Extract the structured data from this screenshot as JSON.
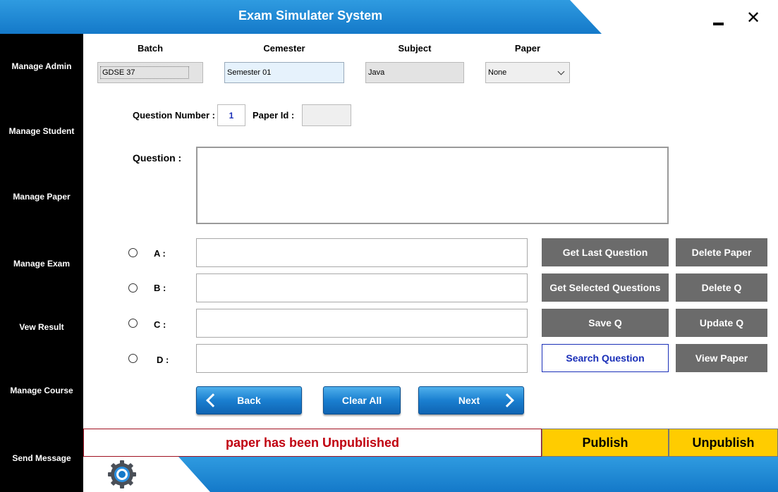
{
  "app": {
    "title": "Exam Simulater System"
  },
  "window": {
    "minimize_icon": "minimize-icon",
    "close_label": "✕"
  },
  "sidebar": {
    "items": [
      {
        "label": "Manage Admin"
      },
      {
        "label": "Manage Student"
      },
      {
        "label": "Manage Paper"
      },
      {
        "label": "Manage Exam"
      },
      {
        "label": "Vew Result"
      },
      {
        "label": "Manage Course"
      },
      {
        "label": "Send Message"
      }
    ]
  },
  "form": {
    "batch": {
      "label": "Batch",
      "value": "GDSE 37"
    },
    "semester": {
      "label": "Cemester",
      "value": "Semester 01"
    },
    "subject": {
      "label": "Subject",
      "value": "Java"
    },
    "paper": {
      "label": "Paper",
      "value": "None"
    },
    "question_number": {
      "label": "Question Number :",
      "value": "1"
    },
    "paper_id": {
      "label": "Paper Id :",
      "value": ""
    },
    "question": {
      "label": "Question :",
      "value": ""
    },
    "options": [
      {
        "label": "A :",
        "value": ""
      },
      {
        "label": "B :",
        "value": ""
      },
      {
        "label": "C :",
        "value": ""
      },
      {
        "label": "D :",
        "value": ""
      }
    ]
  },
  "actions": {
    "get_last_question": "Get Last Question",
    "delete_paper": "Delete Paper",
    "get_selected_questions": "Get Selected Questions",
    "delete_q": "Delete Q",
    "save_q": "Save Q",
    "update_q": "Update Q",
    "search_question": "Search Question",
    "view_paper": "View Paper"
  },
  "navigation": {
    "back": "Back",
    "clear_all": "Clear All",
    "next": "Next"
  },
  "status": {
    "message": "paper has been Unpublished",
    "publish": "Publish",
    "unpublish": "Unpublish"
  },
  "colors": {
    "accent_blue": "#1479c9",
    "sidebar_bg": "#000000",
    "button_gray": "#6b6b6b",
    "publish_yellow": "#ffcc00",
    "status_red": "#c00010"
  }
}
